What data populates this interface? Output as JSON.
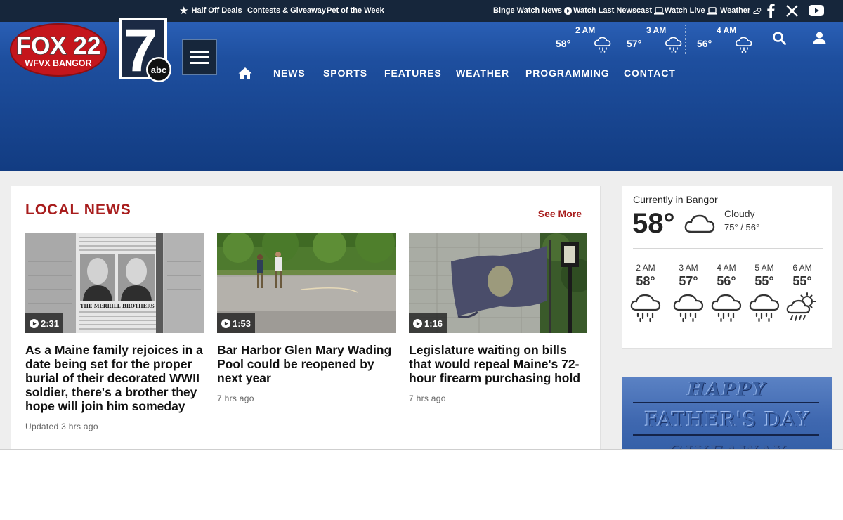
{
  "topbar": {
    "promos": [
      "Half Off Deals",
      "Contests & Giveaway",
      "Pet of the Week"
    ],
    "utility": [
      "Binge Watch News",
      "Watch Last Newscast",
      "Watch Live",
      "Weather"
    ],
    "social_icons": [
      "facebook-icon",
      "x-twitter-icon",
      "youtube-icon"
    ]
  },
  "brand": {
    "station_logo_text": "FOX 22",
    "station_call": "WFVX BANGOR",
    "abc_logo_number": "7",
    "abc_logo_text": "abc"
  },
  "nav": {
    "items": [
      "NEWS",
      "SPORTS",
      "FEATURES",
      "WEATHER",
      "PROGRAMMING",
      "CONTACT"
    ]
  },
  "header_forecast": [
    {
      "hour": "2 AM",
      "temp": "58°",
      "icon": "rain-icon"
    },
    {
      "hour": "3 AM",
      "temp": "57°",
      "icon": "rain-icon"
    },
    {
      "hour": "4 AM",
      "temp": "56°",
      "icon": "rain-icon"
    }
  ],
  "local_news": {
    "title": "LOCAL NEWS",
    "see_more": "See More",
    "stories": [
      {
        "duration": "2:31",
        "headline": "As a Maine family rejoices in a date being set for the proper burial of their decorated WWII soldier, there's a brother they hope will join him someday",
        "meta": "Updated 3 hrs ago",
        "thumb_caption": "THE MERRILL BROTHERS"
      },
      {
        "duration": "1:53",
        "headline": "Bar Harbor Glen Mary Wading Pool could be reopened by next year",
        "meta": "7 hrs ago"
      },
      {
        "duration": "1:16",
        "headline": "Legislature waiting on bills that would repeal Maine's 72-hour firearm purchasing hold",
        "meta": "7 hrs ago"
      }
    ]
  },
  "weather_widget": {
    "location": "Currently in Bangor",
    "temp": "58°",
    "condition": "Cloudy",
    "hi_lo": "75° / 56°",
    "hourly": [
      {
        "hour": "2 AM",
        "temp": "58°",
        "icon": "rain-icon"
      },
      {
        "hour": "3 AM",
        "temp": "57°",
        "icon": "rain-icon"
      },
      {
        "hour": "4 AM",
        "temp": "56°",
        "icon": "rain-icon"
      },
      {
        "hour": "5 AM",
        "temp": "55°",
        "icon": "rain-icon"
      },
      {
        "hour": "6 AM",
        "temp": "55°",
        "icon": "sun-rain-icon"
      }
    ]
  },
  "ad": {
    "line1": "HAPPY",
    "line2": "FATHER'S DAY",
    "line3": "GIVEAWAY"
  },
  "colors": {
    "topbar": "#16263b",
    "header_blue": "#1e4f9f",
    "accent_red": "#a81d1d"
  }
}
